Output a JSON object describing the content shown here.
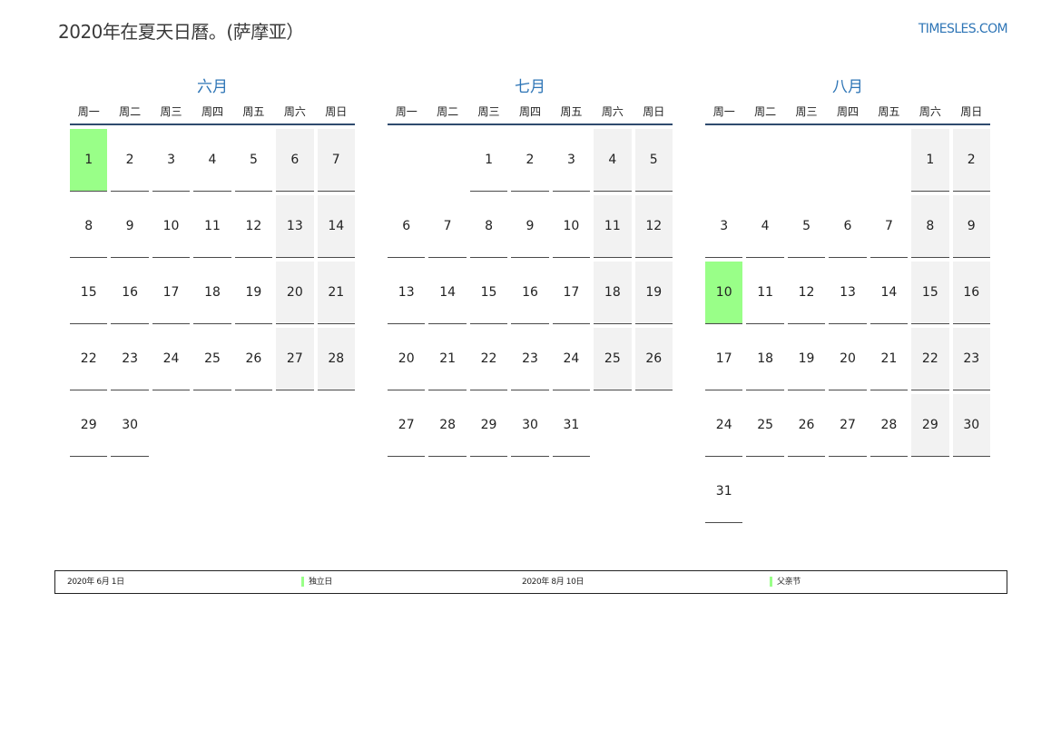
{
  "page": {
    "title": "2020年在夏天日曆。(萨摩亚）",
    "site": "TIMESLES.COM"
  },
  "colors": {
    "accent": "#2e75b6",
    "holiday": "#99ff88",
    "weekend": "#f2f2f2",
    "rule": "#2f4b6e"
  },
  "weekdays": [
    "周一",
    "周二",
    "周三",
    "周四",
    "周五",
    "周六",
    "周日"
  ],
  "months": [
    {
      "name": "六月",
      "weeks": [
        [
          "1",
          "2",
          "3",
          "4",
          "5",
          "6",
          "7"
        ],
        [
          "8",
          "9",
          "10",
          "11",
          "12",
          "13",
          "14"
        ],
        [
          "15",
          "16",
          "17",
          "18",
          "19",
          "20",
          "21"
        ],
        [
          "22",
          "23",
          "24",
          "25",
          "26",
          "27",
          "28"
        ],
        [
          "29",
          "30",
          "",
          "",
          "",
          "",
          ""
        ]
      ],
      "holidays": [
        "1"
      ]
    },
    {
      "name": "七月",
      "weeks": [
        [
          "",
          "",
          "1",
          "2",
          "3",
          "4",
          "5"
        ],
        [
          "6",
          "7",
          "8",
          "9",
          "10",
          "11",
          "12"
        ],
        [
          "13",
          "14",
          "15",
          "16",
          "17",
          "18",
          "19"
        ],
        [
          "20",
          "21",
          "22",
          "23",
          "24",
          "25",
          "26"
        ],
        [
          "27",
          "28",
          "29",
          "30",
          "31",
          "",
          ""
        ]
      ],
      "holidays": []
    },
    {
      "name": "八月",
      "weeks": [
        [
          "",
          "",
          "",
          "",
          "",
          "1",
          "2"
        ],
        [
          "3",
          "4",
          "5",
          "6",
          "7",
          "8",
          "9"
        ],
        [
          "10",
          "11",
          "12",
          "13",
          "14",
          "15",
          "16"
        ],
        [
          "17",
          "18",
          "19",
          "20",
          "21",
          "22",
          "23"
        ],
        [
          "24",
          "25",
          "26",
          "27",
          "28",
          "29",
          "30"
        ],
        [
          "31",
          "",
          "",
          "",
          "",
          "",
          ""
        ]
      ],
      "holidays": [
        "10"
      ]
    }
  ],
  "legend": [
    {
      "date": "2020年 6月 1日",
      "name": "独立日"
    },
    {
      "date": "2020年 8月 10日",
      "name": "父亲节"
    }
  ]
}
